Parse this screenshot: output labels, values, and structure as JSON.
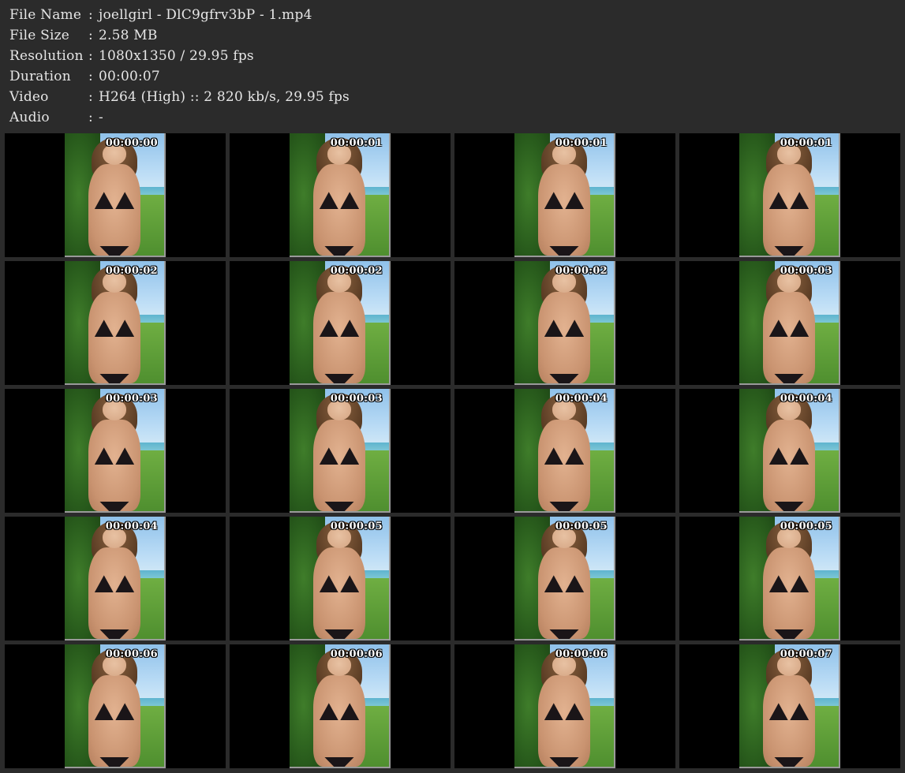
{
  "info": [
    {
      "label": "File Name",
      "sep": ":",
      "value": "joellgirl - DlC9gfrv3bP - 1.mp4"
    },
    {
      "label": "File Size",
      "sep": ":",
      "value": "2.58 MB"
    },
    {
      "label": "Resolution",
      "sep": ":",
      "value": "1080x1350 / 29.95 fps"
    },
    {
      "label": "Duration",
      "sep": ":",
      "value": "00:00:07"
    },
    {
      "label": "Video",
      "sep": ":",
      "value": "H264 (High) :: 2 820 kb/s, 29.95 fps"
    },
    {
      "label": "Audio",
      "sep": ":",
      "value": "-"
    }
  ],
  "thumbnails": [
    {
      "timestamp": "00:00:00"
    },
    {
      "timestamp": "00:00:01"
    },
    {
      "timestamp": "00:00:01"
    },
    {
      "timestamp": "00:00:01"
    },
    {
      "timestamp": "00:00:02"
    },
    {
      "timestamp": "00:00:02"
    },
    {
      "timestamp": "00:00:02"
    },
    {
      "timestamp": "00:00:03"
    },
    {
      "timestamp": "00:00:03"
    },
    {
      "timestamp": "00:00:03"
    },
    {
      "timestamp": "00:00:04"
    },
    {
      "timestamp": "00:00:04"
    },
    {
      "timestamp": "00:00:04"
    },
    {
      "timestamp": "00:00:05"
    },
    {
      "timestamp": "00:00:05"
    },
    {
      "timestamp": "00:00:05"
    },
    {
      "timestamp": "00:00:06"
    },
    {
      "timestamp": "00:00:06"
    },
    {
      "timestamp": "00:00:06"
    },
    {
      "timestamp": "00:00:07"
    }
  ]
}
